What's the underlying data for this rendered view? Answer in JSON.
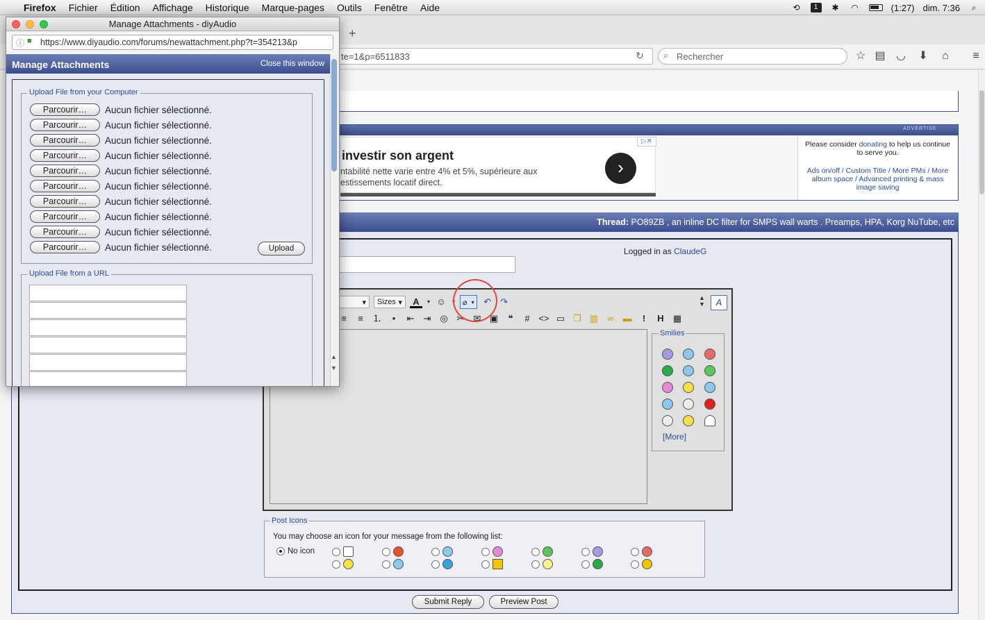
{
  "menubar": {
    "app": "Firefox",
    "items": [
      "Fichier",
      "Édition",
      "Affichage",
      "Historique",
      "Marque-pages",
      "Outils",
      "Fenêtre",
      "Aide"
    ],
    "battery": "(1:27)",
    "clock": "dim. 7:36"
  },
  "browser": {
    "new_tab": "+",
    "url_partial": "te=1&p=6511833",
    "search_placeholder": "Rechercher"
  },
  "ad": {
    "label": "ADVERTISE",
    "title": "investir son argent",
    "line1": "ntabilité nette varie entre 4% et 5%, supérieure aux",
    "line2": "estissements locatif direct.",
    "choice": "▷✕"
  },
  "donate": {
    "text_before": "Please consider ",
    "link": "donating",
    "text_after": " to help us continue to serve you.",
    "features": "Ads on/off / Custom Title / More PMs / More album space / Advanced printing & mass image saving"
  },
  "thread": {
    "label": "Thread:",
    "title": " PO89ZB , an inline DC filter for SMPS wall warts . Preamps, HPA, Korg NuTube, etc"
  },
  "reply": {
    "logged_in_prefix": "Logged in as ",
    "username": "ClaudeG",
    "sizes_label": "Sizes",
    "smilies_label": "Smilies",
    "more_link": "[More]",
    "post_icons_label": "Post Icons",
    "post_icons_desc": "You may choose an icon for your message from the following list:",
    "no_icon": "No icon",
    "submit": "Submit Reply",
    "preview": "Preview Post",
    "colors": {
      "accent": "#3b4d8c",
      "link": "#2b4c9a",
      "highlight": "#e0463d"
    }
  },
  "popup": {
    "window_title": "Manage Attachments - diyAudio",
    "url": "https://www.diyaudio.com/forums/newattachment.php?t=354213&p",
    "header": "Manage Attachments",
    "close": "Close this window",
    "upload_computer_label": "Upload File from your Computer",
    "browse_label": "Parcourir…",
    "no_file": "Aucun fichier sélectionné.",
    "upload_button": "Upload",
    "upload_url_label": "Upload File from a URL"
  }
}
